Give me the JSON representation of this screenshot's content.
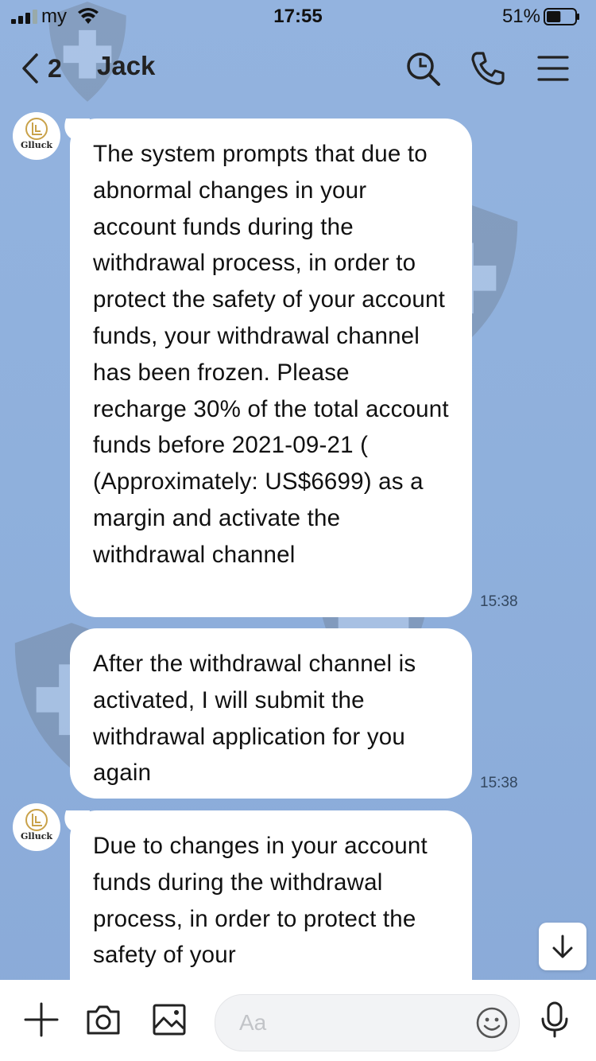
{
  "status_bar": {
    "carrier": "my",
    "time": "17:55",
    "battery_percent": "51%",
    "battery_level": 0.51,
    "icons": [
      "signal-icon",
      "wifi-icon",
      "battery-icon"
    ]
  },
  "header": {
    "back_count": "2",
    "title": "Jack",
    "icons": [
      "chevron-left-icon",
      "search-icon",
      "phone-icon",
      "menu-icon"
    ]
  },
  "avatar": {
    "logo_text": "Glluck"
  },
  "messages": [
    {
      "text": "The system prompts that due to abnormal changes in your account funds during the withdrawal process, in order to protect the safety of your account funds, your withdrawal channel has been frozen. Please recharge 30% of the total account funds before 2021-09-21 ( (Approximately: US$6699) as a margin and activate the withdrawal channel",
      "time": "15:38"
    },
    {
      "text": "After the withdrawal channel is activated, I will submit the withdrawal application for you again",
      "time": "15:38"
    },
    {
      "text": "Due to changes in your account funds during the withdrawal process, in order to protect the safety of your",
      "time": ""
    }
  ],
  "composer": {
    "placeholder": "Aa",
    "value": "",
    "icons": [
      "plus-icon",
      "camera-icon",
      "image-icon",
      "emoji-icon",
      "microphone-icon"
    ]
  },
  "colors": {
    "background": "#8fb0dc",
    "bubble": "#ffffff",
    "text": "#111111",
    "time": "#33475f"
  }
}
